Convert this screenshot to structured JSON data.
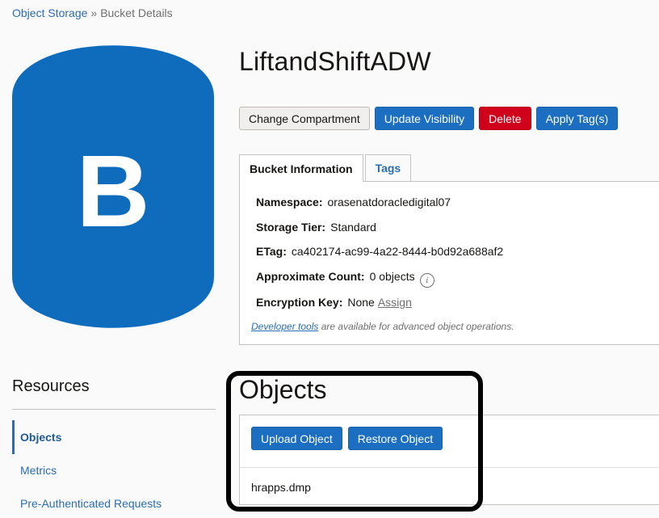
{
  "breadcrumb": {
    "parent": "Object Storage",
    "separator": "»",
    "current": "Bucket Details"
  },
  "bucket": {
    "icon_letter": "B",
    "name": "LiftandShiftADW"
  },
  "actions": {
    "change_compartment": "Change Compartment",
    "update_visibility": "Update Visibility",
    "delete": "Delete",
    "apply_tags": "Apply Tag(s)"
  },
  "tabs": {
    "bucket_information": "Bucket Information",
    "tags": "Tags"
  },
  "info": {
    "namespace_label": "Namespace:",
    "namespace_value": "orasenatdoracledigital07",
    "storage_tier_label": "Storage Tier:",
    "storage_tier_value": "Standard",
    "etag_label": "ETag:",
    "etag_value": "ca402174-ac99-4a22-8444-b0d92a688af2",
    "approx_count_label": "Approximate Count:",
    "approx_count_value": "0 objects",
    "encryption_label": "Encryption Key:",
    "encryption_value": "None",
    "assign": "Assign",
    "info_glyph": "i",
    "dev_tools_link": "Developer tools",
    "dev_tools_note": " are available for advanced object operations."
  },
  "resources": {
    "title": "Resources",
    "items": [
      "Objects",
      "Metrics",
      "Pre-Authenticated Requests"
    ]
  },
  "objects": {
    "title": "Objects",
    "upload": "Upload Object",
    "restore": "Restore Object",
    "rows": [
      "hrapps.dmp"
    ]
  },
  "colors": {
    "accent": "#1c6fc0",
    "danger": "#d0021b",
    "bucket_icon": "#0f6cbd",
    "highlight": "#000000"
  }
}
